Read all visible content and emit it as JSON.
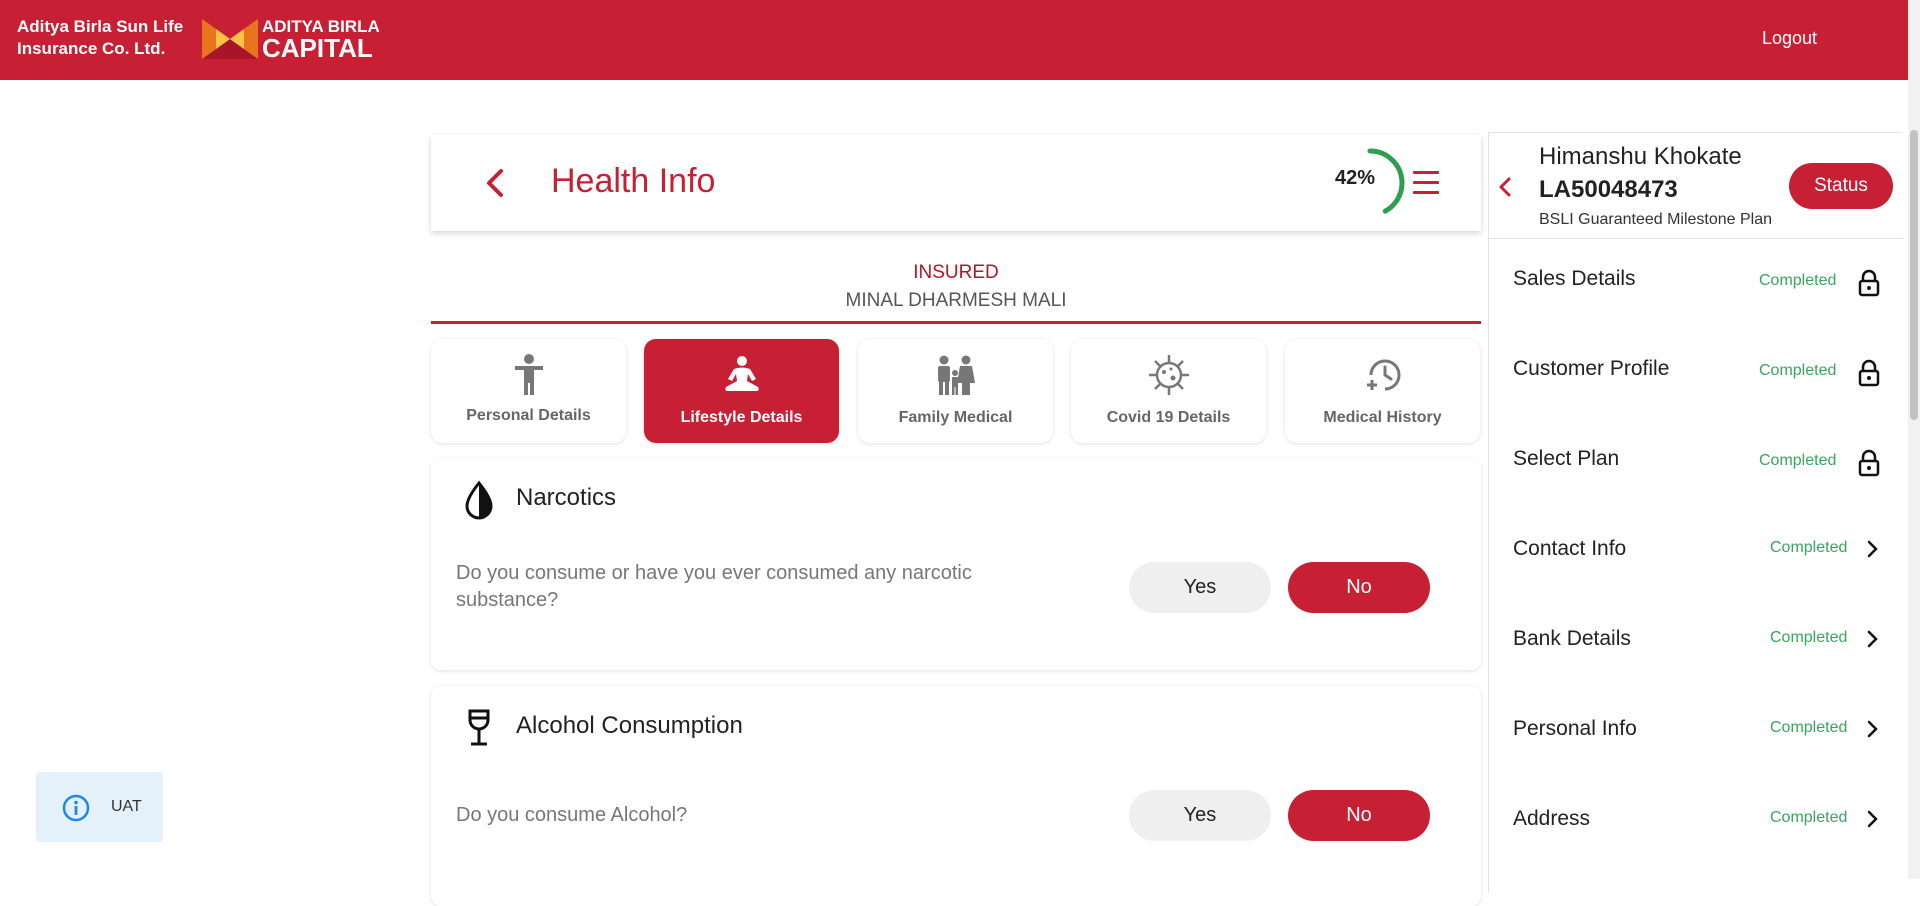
{
  "header": {
    "company_line1": "Aditya Birla Sun Life",
    "company_line2": "Insurance Co. Ltd.",
    "logo_line1": "ADITYA BIRLA",
    "logo_line2": "CAPITAL",
    "logout": "Logout"
  },
  "health_info": {
    "title": "Health Info",
    "progress_text": "42%",
    "progress_value": 0.42
  },
  "insured": {
    "label": "INSURED",
    "name": "MINAL DHARMESH MALI"
  },
  "tabs": [
    {
      "label": "Personal Details",
      "icon": "person-icon",
      "active": false
    },
    {
      "label": "Lifestyle Details",
      "icon": "meditation-icon",
      "active": true
    },
    {
      "label": "Family Medical",
      "icon": "family-icon",
      "active": false
    },
    {
      "label": "Covid 19 Details",
      "icon": "virus-icon",
      "active": false
    },
    {
      "label": "Medical History",
      "icon": "history-icon",
      "active": false
    }
  ],
  "questions": [
    {
      "title": "Narcotics",
      "text": "Do you consume or have you ever consumed any narcotic substance?",
      "yes": "Yes",
      "no": "No",
      "selected": "No",
      "icon": "drop-icon"
    },
    {
      "title": "Alcohol Consumption",
      "text": "Do you consume Alcohol?",
      "yes": "Yes",
      "no": "No",
      "selected": "No",
      "icon": "wine-glass-icon"
    }
  ],
  "panel": {
    "name": "Himanshu Khokate",
    "id": "LA50048473",
    "plan": "BSLI Guaranteed Milestone Plan",
    "status_button": "Status",
    "items": [
      {
        "label": "Sales Details",
        "status": "Completed",
        "icon": "lock-icon"
      },
      {
        "label": "Customer Profile",
        "status": "Completed",
        "icon": "lock-icon"
      },
      {
        "label": "Select Plan",
        "status": "Completed",
        "icon": "lock-icon"
      },
      {
        "label": "Contact Info",
        "status": "Completed",
        "icon": "chevron-right-icon"
      },
      {
        "label": "Bank Details",
        "status": "Completed",
        "icon": "chevron-right-icon"
      },
      {
        "label": "Personal Info",
        "status": "Completed",
        "icon": "chevron-right-icon"
      },
      {
        "label": "Address",
        "status": "Completed",
        "icon": "chevron-right-icon"
      }
    ]
  },
  "uat": {
    "label": "UAT"
  },
  "colors": {
    "brand": "#c71f33",
    "completed": "#3aa55d",
    "progress": "#2e9e4f"
  }
}
